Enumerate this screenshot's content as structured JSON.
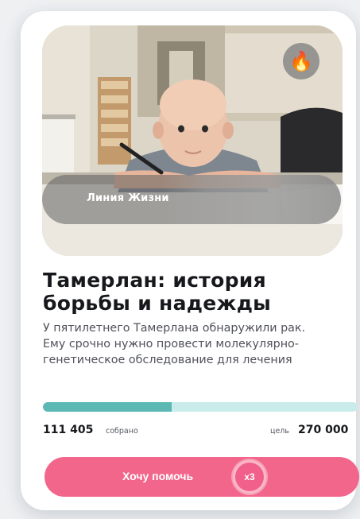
{
  "campaign": {
    "org_name": "Линия Жизни",
    "title": "Тамерлан: история борьбы и надежды",
    "description": "У пятилетнего Тамерлана обнаружили рак. Ему срочно нужно провести молекулярно-генетическое обследование для лечения",
    "badge_icon": "fire-icon",
    "badge_glyph": "🔥"
  },
  "funding": {
    "raised": "111 405",
    "raised_caption": "собрано",
    "goal_caption": "цель",
    "goal": "270 000",
    "progress_fraction": 0.41
  },
  "cta": {
    "label": "Хочу помочь",
    "multiplier": "x3"
  },
  "colors": {
    "accent": "#f2668b",
    "progress_fill": "#5bb8b3",
    "progress_track": "#c9ecea",
    "title_text": "#17181c"
  }
}
